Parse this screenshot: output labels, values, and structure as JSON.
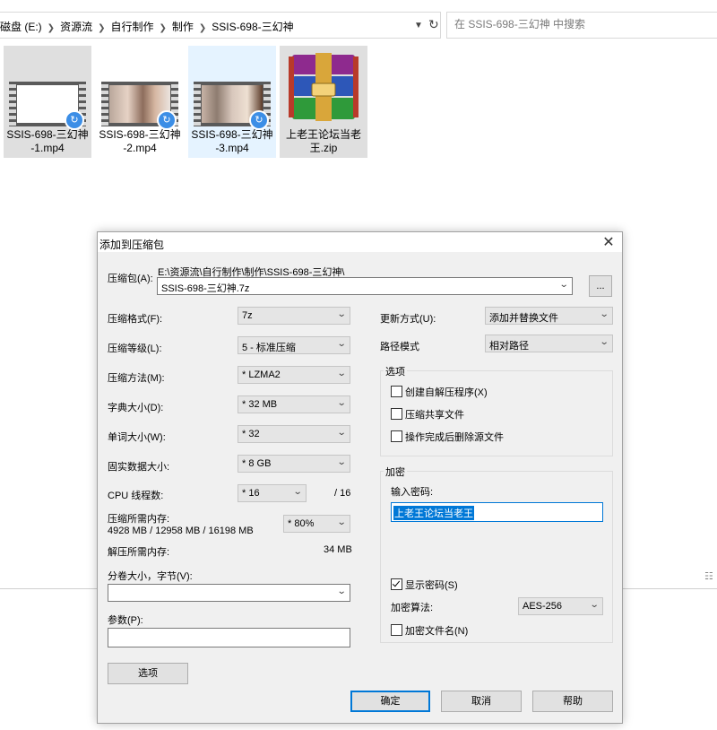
{
  "explorer": {
    "breadcrumbs": [
      "磁盘 (E:)",
      "资源流",
      "自行制作",
      "制作",
      "SSIS-698-三幻神"
    ],
    "search_placeholder": "在 SSIS-698-三幻神 中搜索",
    "files": [
      {
        "name": "SSIS-698-三幻神-1.mp4",
        "line1": "SSIS-698-三幻神",
        "line2": "-1.mp4",
        "icon": "video-icon"
      },
      {
        "name": "SSIS-698-三幻神-2.mp4",
        "line1": "SSIS-698-三幻神",
        "line2": "-2.mp4",
        "icon": "video-icon"
      },
      {
        "name": "SSIS-698-三幻神-3.mp4",
        "line1": "SSIS-698-三幻神",
        "line2": "-3.mp4",
        "icon": "video-icon"
      },
      {
        "name": "上老王论坛当老王.zip",
        "line1": "上老王论坛当老",
        "line2": "王.zip",
        "icon": "winrar-archive-icon"
      }
    ]
  },
  "dialog": {
    "title": "添加到压缩包",
    "archive_label": "压缩包(A):",
    "archive_path": "E:\\资源流\\自行制作\\制作\\SSIS-698-三幻神\\",
    "archive_name": "SSIS-698-三幻神.7z",
    "browse_label": "...",
    "left": {
      "format_label": "压缩格式(F):",
      "format_value": "7z",
      "level_label": "压缩等级(L):",
      "level_value": "5 - 标准压缩",
      "method_label": "压缩方法(M):",
      "method_value": "* LZMA2",
      "dict_label": "字典大小(D):",
      "dict_value": "* 32 MB",
      "word_label": "单词大小(W):",
      "word_value": "* 32",
      "solid_label": "固实数据大小:",
      "solid_value": "* 8 GB",
      "threads_label": "CPU 线程数:",
      "threads_value": "* 16",
      "threads_total": "/ 16",
      "mem_label": "压缩所需内存:",
      "mem_detail": "4928 MB / 12958 MB / 16198 MB",
      "mem_value": "* 80%",
      "decomp_label": "解压所需内存:",
      "decomp_value": "34 MB",
      "volume_label": "分卷大小，字节(V):",
      "volume_value": "",
      "params_label": "参数(P):",
      "params_value": "",
      "options_button": "选项"
    },
    "right": {
      "update_label": "更新方式(U):",
      "update_value": "添加并替换文件",
      "path_label": "路径模式",
      "path_value": "相对路径",
      "options_group": "选项",
      "opt_sfx": "创建自解压程序(X)",
      "opt_shared": "压缩共享文件",
      "opt_delete": "操作完成后删除源文件",
      "encrypt_group": "加密",
      "password_label": "输入密码:",
      "password_value": "上老王论坛当老王",
      "show_password": "显示密码(S)",
      "method_label": "加密算法:",
      "method_value": "AES-256",
      "encrypt_names": "加密文件名(N)"
    },
    "buttons": {
      "ok": "确定",
      "cancel": "取消",
      "help": "帮助"
    }
  }
}
